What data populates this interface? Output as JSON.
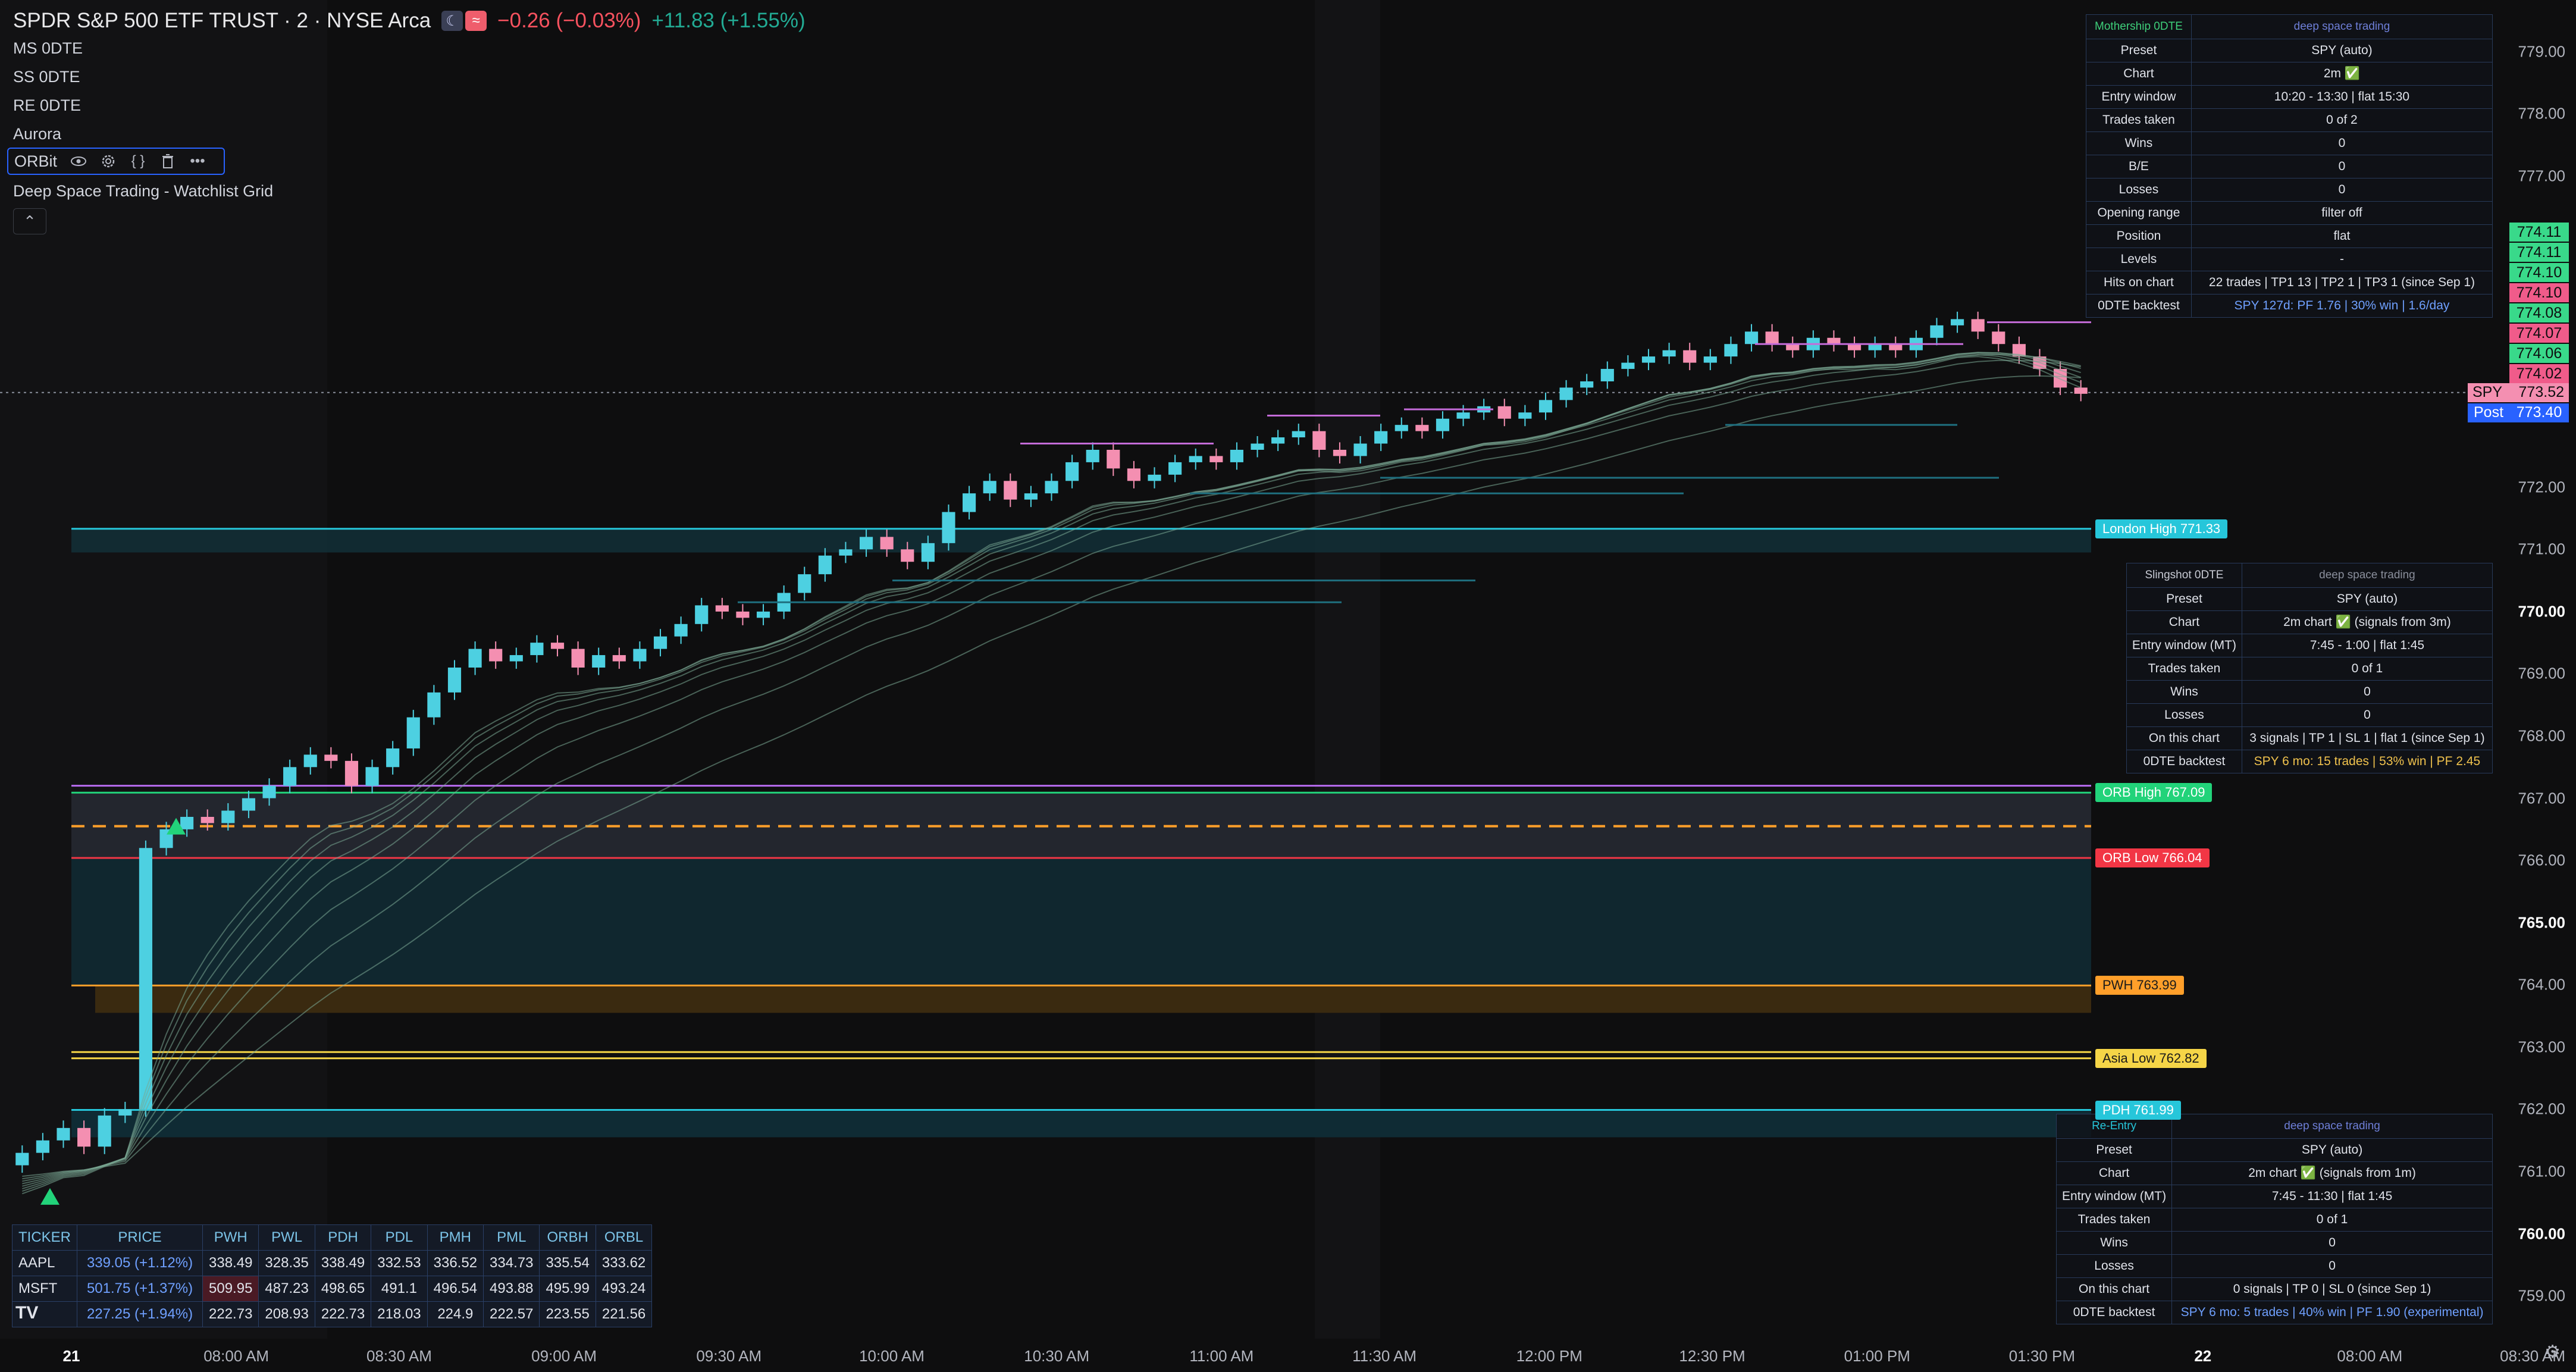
{
  "header": {
    "title": "SPDR S&P 500 ETF TRUST · 2 · NYSE Arca",
    "marker_moon": "☾",
    "marker_wave": "≈",
    "change_day": "−0.26 (−0.03%)",
    "change_ext": "+11.83 (+1.55%)"
  },
  "indicators": [
    "MS 0DTE",
    "SS 0DTE",
    "RE 0DTE",
    "Aurora"
  ],
  "orbit": {
    "label": "ORBit"
  },
  "watchlist_label": "Deep Space Trading - Watchlist Grid",
  "mothership": {
    "title": "Mothership 0DTE",
    "subtitle": "deep space trading",
    "rows": [
      [
        "Preset",
        "SPY (auto)"
      ],
      [
        "Chart",
        "2m ✅"
      ],
      [
        "Entry window",
        "10:20 - 13:30 | flat 15:30"
      ],
      [
        "Trades taken",
        "0 of 2"
      ],
      [
        "Wins",
        "0"
      ],
      [
        "B/E",
        "0"
      ],
      [
        "Losses",
        "0"
      ],
      [
        "Opening range",
        "filter off"
      ],
      [
        "Position",
        "flat"
      ],
      [
        "Levels",
        "-"
      ],
      [
        "Hits on chart",
        "22 trades | TP1 13 | TP2 1 | TP3 1 (since Sep 1)"
      ],
      [
        "0DTE backtest",
        "SPY 127d: PF 1.76 | 30% win | 1.6/day"
      ]
    ]
  },
  "slingshot": {
    "title": "Slingshot 0DTE",
    "subtitle": "deep space trading",
    "rows": [
      [
        "Preset",
        "SPY (auto)"
      ],
      [
        "Chart",
        "2m chart ✅ (signals from 3m)"
      ],
      [
        "Entry window (MT)",
        "7:45 - 1:00 | flat 1:45"
      ],
      [
        "Trades taken",
        "0 of 1"
      ],
      [
        "Wins",
        "0"
      ],
      [
        "Losses",
        "0"
      ],
      [
        "On this chart",
        "3 signals | TP 1 | SL 1 | flat 1 (since Sep 1)"
      ],
      [
        "0DTE backtest",
        "SPY 6 mo: 15 trades | 53% win | PF 2.45"
      ]
    ]
  },
  "reentry": {
    "title": "Re-Entry",
    "subtitle": "deep space trading",
    "rows": [
      [
        "Preset",
        "SPY (auto)"
      ],
      [
        "Chart",
        "2m chart ✅ (signals from 1m)"
      ],
      [
        "Entry window (MT)",
        "7:45 - 11:30 | flat 1:45"
      ],
      [
        "Trades taken",
        "0 of 1"
      ],
      [
        "Wins",
        "0"
      ],
      [
        "Losses",
        "0"
      ],
      [
        "On this chart",
        "0 signals | TP 0 | SL 0 (since Sep 1)"
      ],
      [
        "0DTE backtest",
        "SPY 6 mo: 5 trades | 40% win | PF 1.90 (experimental)"
      ]
    ]
  },
  "watchlist": {
    "headers": [
      "TICKER",
      "PRICE",
      "PWH",
      "PWL",
      "PDH",
      "PDL",
      "PMH",
      "PML",
      "ORBH",
      "ORBL"
    ],
    "rows": [
      [
        "AAPL",
        "339.05 (+1.12%)",
        "338.49",
        "328.35",
        "338.49",
        "332.53",
        "336.52",
        "334.73",
        "335.54",
        "333.62"
      ],
      [
        "MSFT",
        "501.75 (+1.37%)",
        "509.95",
        "487.23",
        "498.65",
        "491.1",
        "496.54",
        "493.88",
        "495.99",
        "493.24"
      ],
      [
        "",
        "227.25 (+1.94%)",
        "222.73",
        "208.93",
        "222.73",
        "218.03",
        "224.9",
        "222.57",
        "223.55",
        "221.56"
      ]
    ],
    "logo": "TV"
  },
  "chart_data": {
    "type": "candlestick",
    "symbol": "SPY",
    "y_range": [
      758.6,
      779.6
    ],
    "y_ticks": [
      {
        "v": 779.0,
        "bold": false
      },
      {
        "v": 778.0,
        "bold": false
      },
      {
        "v": 777.0,
        "bold": false
      },
      {
        "v": 772.0,
        "bold": false
      },
      {
        "v": 771.0,
        "bold": false
      },
      {
        "v": 770.0,
        "bold": true
      },
      {
        "v": 769.0,
        "bold": false
      },
      {
        "v": 768.0,
        "bold": false
      },
      {
        "v": 767.0,
        "bold": false
      },
      {
        "v": 766.0,
        "bold": false
      },
      {
        "v": 765.0,
        "bold": true
      },
      {
        "v": 764.0,
        "bold": false
      },
      {
        "v": 763.0,
        "bold": false
      },
      {
        "v": 762.0,
        "bold": false
      },
      {
        "v": 761.0,
        "bold": false
      },
      {
        "v": 760.0,
        "bold": true
      },
      {
        "v": 759.0,
        "bold": false
      }
    ],
    "y_tick_labels": [
      "779.00",
      "778.00",
      "777.00",
      "772.00",
      "771.00",
      "770.00",
      "769.00",
      "768.00",
      "767.00",
      "766.00",
      "765.00",
      "764.00",
      "763.00",
      "762.00",
      "761.00",
      "760.00",
      "759.00"
    ],
    "time_labels": [
      {
        "t": "21",
        "bold": true,
        "x": 0
      },
      {
        "t": "08:00 AM",
        "x": 0.082
      },
      {
        "t": "08:30 AM",
        "x": 0.163
      },
      {
        "t": "09:00 AM",
        "x": 0.245
      },
      {
        "t": "09:30 AM",
        "x": 0.327
      },
      {
        "t": "10:00 AM",
        "x": 0.408
      },
      {
        "t": "10:30 AM",
        "x": 0.49
      },
      {
        "t": "11:00 AM",
        "x": 0.572
      },
      {
        "t": "11:30 AM",
        "x": 0.653
      },
      {
        "t": "12:00 PM",
        "x": 0.735
      },
      {
        "t": "12:30 PM",
        "x": 0.816
      },
      {
        "t": "01:00 PM",
        "x": 0.898
      },
      {
        "t": "01:30 PM",
        "x": 0.98
      },
      {
        "t": "22",
        "bold": true,
        "x": 1.06
      },
      {
        "t": "08:00 AM",
        "x": 1.143
      },
      {
        "t": "08:30 AM",
        "x": 1.224
      }
    ],
    "time_label_text": [
      "21",
      "08:00 AM",
      "08:30 AM",
      "09:00 AM",
      "09:30 AM",
      "10:00 AM",
      "10:30 AM",
      "11:00 AM",
      "11:30 AM",
      "12:00 PM",
      "12:30 PM",
      "01:00 PM",
      "01:30 PM",
      "22",
      "08:00 AM",
      "08:30 AM"
    ],
    "closes": [
      761.3,
      761.5,
      761.7,
      761.4,
      761.9,
      762.0,
      766.2,
      766.5,
      766.7,
      766.6,
      766.8,
      767.0,
      767.2,
      767.5,
      767.7,
      767.6,
      767.2,
      767.5,
      767.8,
      768.3,
      768.7,
      769.1,
      769.4,
      769.2,
      769.3,
      769.5,
      769.4,
      769.1,
      769.3,
      769.2,
      769.4,
      769.6,
      769.8,
      770.1,
      770.0,
      769.9,
      770.0,
      770.3,
      770.6,
      770.9,
      771.0,
      771.2,
      771.0,
      770.8,
      771.1,
      771.6,
      771.9,
      772.1,
      771.8,
      771.9,
      772.1,
      772.4,
      772.6,
      772.3,
      772.1,
      772.2,
      772.4,
      772.5,
      772.4,
      772.6,
      772.7,
      772.8,
      772.9,
      772.6,
      772.5,
      772.7,
      772.9,
      773.0,
      772.9,
      773.1,
      773.2,
      773.3,
      773.1,
      773.2,
      773.4,
      773.6,
      773.7,
      773.9,
      774.0,
      774.1,
      774.2,
      774.0,
      774.1,
      774.3,
      774.5,
      774.3,
      774.2,
      774.4,
      774.3,
      774.2,
      774.3,
      774.2,
      774.4,
      774.6,
      774.7,
      774.5,
      774.3,
      774.1,
      773.9,
      773.6,
      773.5
    ],
    "levels": [
      {
        "name": "London High",
        "value": 771.33,
        "label": "London High 771.33",
        "color": "#26c6da"
      },
      {
        "name": "ORB High",
        "value": 767.09,
        "label": "ORB High 767.09",
        "color": "#22d37a"
      },
      {
        "name": "ORB Low",
        "value": 766.04,
        "label": "ORB Low 766.04",
        "color": "#f23645"
      },
      {
        "name": "PWH",
        "value": 763.99,
        "label": "PWH 763.99",
        "color": "#ff9f2a"
      },
      {
        "name": "Asia Low",
        "value": 762.82,
        "label": "Asia Low 762.82",
        "color": "#f5d547"
      },
      {
        "name": "PDH",
        "value": 761.99,
        "label": "PDH 761.99",
        "color": "#26c6da"
      }
    ],
    "level_labels": [
      "London High 771.33",
      "ORB High 767.09",
      "ORB Low 766.04",
      "PWH 763.99",
      "Asia Low 762.82",
      "PDH 761.99"
    ],
    "price_tags": [
      {
        "v": "774.11",
        "color": "#39d98a"
      },
      {
        "v": "774.11",
        "color": "#39d98a"
      },
      {
        "v": "774.10",
        "color": "#39d98a"
      },
      {
        "v": "774.10",
        "color": "#f05b8a"
      },
      {
        "v": "774.08",
        "color": "#39d98a"
      },
      {
        "v": "774.07",
        "color": "#f05b8a"
      },
      {
        "v": "774.06",
        "color": "#39d98a"
      },
      {
        "v": "774.02",
        "color": "#f05b8a"
      }
    ],
    "price_tag_values": [
      "774.11",
      "774.11",
      "774.10",
      "774.10",
      "774.08",
      "774.07",
      "774.06",
      "774.02"
    ],
    "last_price": {
      "symbol": "SPY",
      "value": "773.52"
    },
    "post_price": {
      "label": "Post",
      "value": "773.40"
    },
    "colors": {
      "up": "#4dd0e1",
      "down": "#f48fb1",
      "ema": "#7aa894",
      "orb_mid": "#ff9f2a",
      "signal": "#22d37a"
    }
  }
}
